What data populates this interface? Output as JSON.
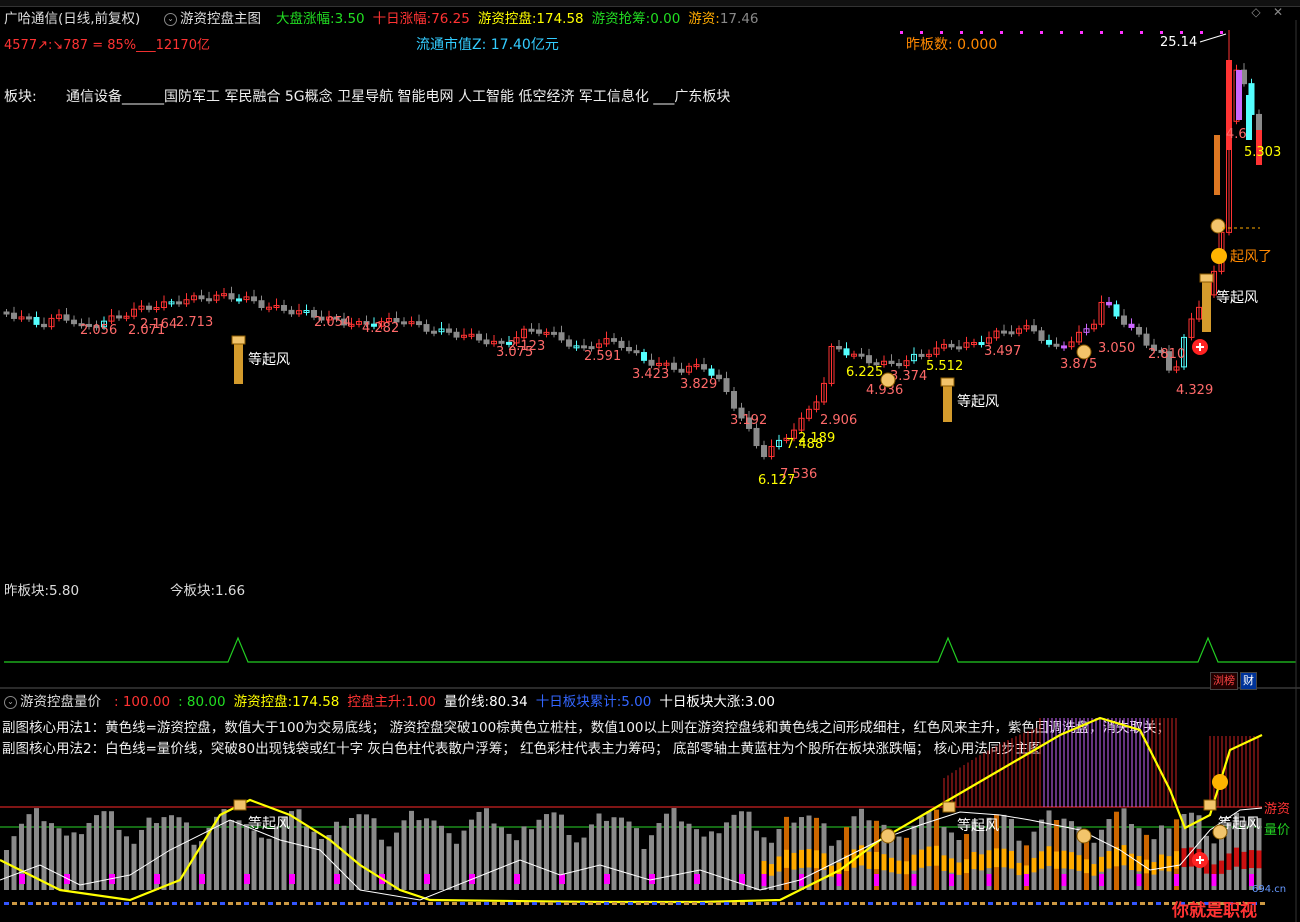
{
  "header": {
    "stock_title": "广哈通信(日线,前复权)",
    "indicator_name": "游资控盘主图",
    "items": [
      {
        "label": "大盘涨幅:",
        "value": "3.50",
        "color": "#22dd22"
      },
      {
        "label": "十日涨幅:",
        "value": "76.25",
        "color": "#ff3333"
      },
      {
        "label": "游资控盘:",
        "value": "174.58",
        "color": "#ffff00"
      },
      {
        "label": "游资抢筹:",
        "value": "0.00",
        "color": "#22dd22"
      },
      {
        "label": "游资:",
        "value": "17.46",
        "color": "#bb8833"
      }
    ],
    "line2_left": "4577↗:↘787 = 85%___12170亿",
    "float_cap": "流通市值Z: 17.40亿元",
    "prev_limit_count": "昨板数: 0.000"
  },
  "sector_line": {
    "label": "板块:",
    "text": "通信设备______国防军工 军民融合 5G概念 卫星导航 智能电网 人工智能 低空经济 军工信息化 ___广东板块"
  },
  "annotations": {
    "peak_price": "25.14",
    "wait_wind": "等起风",
    "wind_rising": "起风了",
    "price_labels": [
      {
        "text": "2.056",
        "color": "#ff6a6a"
      },
      {
        "text": "2.071",
        "color": "#ff6a6a"
      },
      {
        "text": "2.164",
        "color": "#ff6a6a"
      },
      {
        "text": "2.713",
        "color": "#ff6a6a"
      },
      {
        "text": "2.054",
        "color": "#ff6a6a"
      },
      {
        "text": "4.282",
        "color": "#ff6a6a"
      },
      {
        "text": "3.075",
        "color": "#ff6a6a"
      },
      {
        "text": "2.123",
        "color": "#ff6a6a"
      },
      {
        "text": "2.591",
        "color": "#ff6a6a"
      },
      {
        "text": "3.423",
        "color": "#ff6a6a"
      },
      {
        "text": "3.829",
        "color": "#ff6a6a"
      },
      {
        "text": "3.192",
        "color": "#ff6a6a"
      },
      {
        "text": "6.127",
        "color": "#ffff00"
      },
      {
        "text": "7.536",
        "color": "#ff6a6a"
      },
      {
        "text": "7.488",
        "color": "#ffff00"
      },
      {
        "text": "2.189",
        "color": "#ffff00"
      },
      {
        "text": "2.906",
        "color": "#ff6a6a"
      },
      {
        "text": "6.225",
        "color": "#ffff00"
      },
      {
        "text": "3.374",
        "color": "#ff6a6a"
      },
      {
        "text": "4.936",
        "color": "#ff6a6a"
      },
      {
        "text": "5.512",
        "color": "#ffff00"
      },
      {
        "text": "3.497",
        "color": "#ff6a6a"
      },
      {
        "text": "3.875",
        "color": "#ff6a6a"
      },
      {
        "text": "3.050",
        "color": "#ff6a6a"
      },
      {
        "text": "2.810",
        "color": "#ff6a6a"
      },
      {
        "text": "4.329",
        "color": "#ff6a6a"
      },
      {
        "text": "4.6",
        "color": "#ff6a6a"
      },
      {
        "text": "5.303",
        "color": "#ffff00"
      }
    ]
  },
  "sector_panel": {
    "prev_block": "昨板块:5.80",
    "today_block": "今板块:1.66"
  },
  "badges": {
    "rank": "浏榜",
    "finance": "财"
  },
  "sub_header": {
    "name": "游资控盘量价",
    "items": [
      {
        "label": "",
        "value": ": 100.00",
        "color": "#ff3333"
      },
      {
        "label": "",
        "value": ": 80.00",
        "color": "#22dd22"
      },
      {
        "label": "游资控盘:",
        "value": "174.58",
        "color": "#ffff00"
      },
      {
        "label": "控盘主升:",
        "value": "1.00",
        "color": "#ff3333"
      },
      {
        "label": "量价线:",
        "value": "80.34",
        "color": "#ffffff"
      },
      {
        "label": "十日板块累计:",
        "value": "5.00",
        "color": "#3366ff"
      },
      {
        "label": "十日板块大涨:",
        "value": "3.00",
        "color": "#ffffff"
      }
    ]
  },
  "sub_notes": {
    "line1": "副图核心用法1：黄色线=游资控盘，数值大于100为交易底线；  游资控盘突破100棕黄色立桩柱，数值100以上则在游资控盘线和黄色线之间形成细柱，红色风来主升，紫色回调洗盘，消失取关；",
    "line2": "副图核心用法2：白色线=量价线，突破80出现钱袋或红十字   灰白色柱代表散户浮筹；   红色彩柱代表主力筹码；   底部零轴土黄蓝柱为个股所在板块涨跌幅；   核心用法同步主图"
  },
  "sub_legend": {
    "yz": "游资",
    "lj": "量价"
  },
  "watermark": {
    "brand": "你就是职视",
    "site": "694.cn"
  },
  "colors": {
    "up": "#ff3333",
    "down": "#54ffff",
    "gray": "#8a8a8a",
    "yellow": "#ffff00",
    "orange": "#ffaa00",
    "magenta": "#ff00ff",
    "green": "#22cc22"
  }
}
